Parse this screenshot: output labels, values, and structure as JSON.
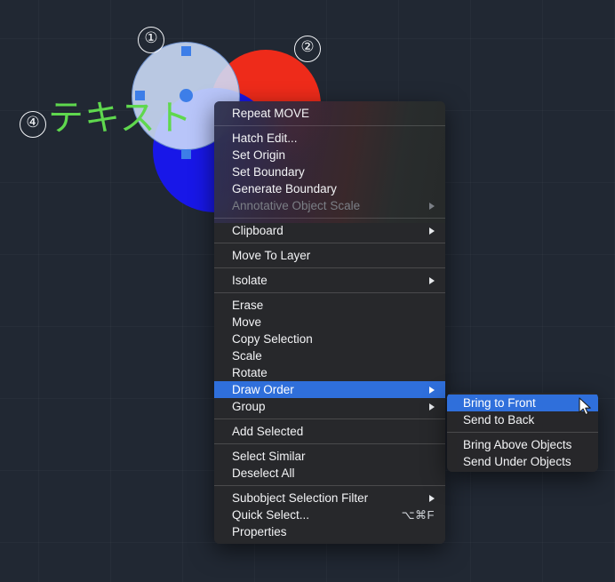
{
  "canvas": {
    "background_color": "#212833",
    "grid_color": "#2a313d",
    "annotation_text": "テキスト",
    "annotation_color": "#5fd84e",
    "markers": [
      {
        "label": "①",
        "name": "marker-1"
      },
      {
        "label": "②",
        "name": "marker-2"
      },
      {
        "label": "④",
        "name": "marker-4"
      }
    ],
    "shapes": [
      {
        "name": "selected-circle",
        "color": "#cedefa",
        "outline": "#6d8fcb",
        "selected": true
      },
      {
        "name": "red-circle",
        "color": "#ee2b1a",
        "selected": false
      },
      {
        "name": "blue-circle",
        "color": "#1817e8",
        "selected": false
      }
    ],
    "grip_color": "#3d7ee8"
  },
  "context_menu": {
    "highlight_color": "#2f6fdb",
    "groups": [
      {
        "items": [
          {
            "label": "Repeat MOVE",
            "accel": "",
            "arrow": false,
            "disabled": false,
            "selected": false
          }
        ]
      },
      {
        "items": [
          {
            "label": "Hatch Edit...",
            "accel": "",
            "arrow": false,
            "disabled": false,
            "selected": false
          },
          {
            "label": "Set Origin",
            "accel": "",
            "arrow": false,
            "disabled": false,
            "selected": false
          },
          {
            "label": "Set Boundary",
            "accel": "",
            "arrow": false,
            "disabled": false,
            "selected": false
          },
          {
            "label": "Generate Boundary",
            "accel": "",
            "arrow": false,
            "disabled": false,
            "selected": false
          },
          {
            "label": "Annotative Object Scale",
            "accel": "",
            "arrow": true,
            "disabled": true,
            "selected": false
          }
        ]
      },
      {
        "items": [
          {
            "label": "Clipboard",
            "accel": "",
            "arrow": true,
            "disabled": false,
            "selected": false
          }
        ]
      },
      {
        "items": [
          {
            "label": "Move To Layer",
            "accel": "",
            "arrow": false,
            "disabled": false,
            "selected": false
          }
        ]
      },
      {
        "items": [
          {
            "label": "Isolate",
            "accel": "",
            "arrow": true,
            "disabled": false,
            "selected": false
          }
        ]
      },
      {
        "items": [
          {
            "label": "Erase",
            "accel": "",
            "arrow": false,
            "disabled": false,
            "selected": false
          },
          {
            "label": "Move",
            "accel": "",
            "arrow": false,
            "disabled": false,
            "selected": false
          },
          {
            "label": "Copy Selection",
            "accel": "",
            "arrow": false,
            "disabled": false,
            "selected": false
          },
          {
            "label": "Scale",
            "accel": "",
            "arrow": false,
            "disabled": false,
            "selected": false
          },
          {
            "label": "Rotate",
            "accel": "",
            "arrow": false,
            "disabled": false,
            "selected": false
          },
          {
            "label": "Draw Order",
            "accel": "",
            "arrow": true,
            "disabled": false,
            "selected": true
          },
          {
            "label": "Group",
            "accel": "",
            "arrow": true,
            "disabled": false,
            "selected": false
          }
        ]
      },
      {
        "items": [
          {
            "label": "Add Selected",
            "accel": "",
            "arrow": false,
            "disabled": false,
            "selected": false
          }
        ]
      },
      {
        "items": [
          {
            "label": "Select Similar",
            "accel": "",
            "arrow": false,
            "disabled": false,
            "selected": false
          },
          {
            "label": "Deselect All",
            "accel": "",
            "arrow": false,
            "disabled": false,
            "selected": false
          }
        ]
      },
      {
        "items": [
          {
            "label": "Subobject Selection Filter",
            "accel": "",
            "arrow": true,
            "disabled": false,
            "selected": false
          },
          {
            "label": "Quick Select...",
            "accel": "⌥⌘F",
            "arrow": false,
            "disabled": false,
            "selected": false
          },
          {
            "label": "Properties",
            "accel": "",
            "arrow": false,
            "disabled": false,
            "selected": false
          }
        ]
      }
    ]
  },
  "submenu": {
    "parent": "Draw Order",
    "groups": [
      {
        "items": [
          {
            "label": "Bring to Front",
            "accel": "",
            "arrow": false,
            "disabled": false,
            "selected": true
          },
          {
            "label": "Send to Back",
            "accel": "",
            "arrow": false,
            "disabled": false,
            "selected": false
          }
        ]
      },
      {
        "items": [
          {
            "label": "Bring Above Objects",
            "accel": "",
            "arrow": false,
            "disabled": false,
            "selected": false
          },
          {
            "label": "Send Under Objects",
            "accel": "",
            "arrow": false,
            "disabled": false,
            "selected": false
          }
        ]
      }
    ]
  }
}
